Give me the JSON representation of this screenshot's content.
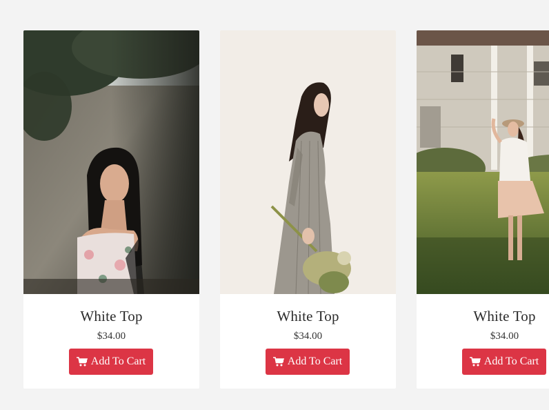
{
  "products": [
    {
      "name": "White Top",
      "price": "$34.00",
      "button_label": "Add To Cart",
      "button_icon": "cart-icon",
      "image": "woman-in-floral-off-shoulder-top-by-wall"
    },
    {
      "name": "White Top",
      "price": "$34.00",
      "button_label": "Add To Cart",
      "button_icon": "cart-icon",
      "image": "woman-in-grey-dress-holding-dried-flowers"
    },
    {
      "name": "White Top",
      "price": "$34.00",
      "button_label": "Add To Cart",
      "button_icon": "cart-icon",
      "image": "woman-in-white-top-and-pink-skirt-in-field"
    }
  ],
  "colors": {
    "background": "#f3f3f3",
    "card": "#ffffff",
    "button": "#dc3545",
    "button_text": "#ffffff",
    "title_text": "#2b2b2b"
  }
}
